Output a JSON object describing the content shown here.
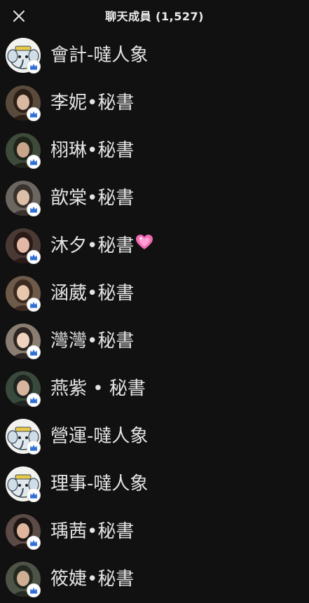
{
  "header": {
    "title": "聊天成員 (1,527)",
    "close_icon": "close-icon"
  },
  "badge_icon": "crown-icon",
  "accent_color": "#2f6fd6",
  "members": [
    {
      "name": "會計-噠人象",
      "avatar": "mascot-avatar",
      "heart": false
    },
    {
      "name": "李妮•秘書",
      "avatar": "photo-avatar",
      "heart": false
    },
    {
      "name": "栩琳•秘書",
      "avatar": "photo-avatar",
      "heart": false
    },
    {
      "name": "歆棠•秘書",
      "avatar": "photo-avatar",
      "heart": false
    },
    {
      "name": "沐夕•秘書",
      "avatar": "photo-avatar",
      "heart": true
    },
    {
      "name": "涵葳•秘書",
      "avatar": "photo-avatar",
      "heart": false
    },
    {
      "name": "灣灣•秘書",
      "avatar": "photo-avatar",
      "heart": false
    },
    {
      "name": "燕紫 • 秘書",
      "avatar": "photo-avatar",
      "heart": false
    },
    {
      "name": "營運-噠人象",
      "avatar": "mascot-avatar",
      "heart": false
    },
    {
      "name": "理事-噠人象",
      "avatar": "mascot-avatar",
      "heart": false
    },
    {
      "name": "瑀茜•秘書",
      "avatar": "photo-avatar",
      "heart": false
    },
    {
      "name": "筱婕•秘書",
      "avatar": "photo-avatar",
      "heart": false
    }
  ]
}
